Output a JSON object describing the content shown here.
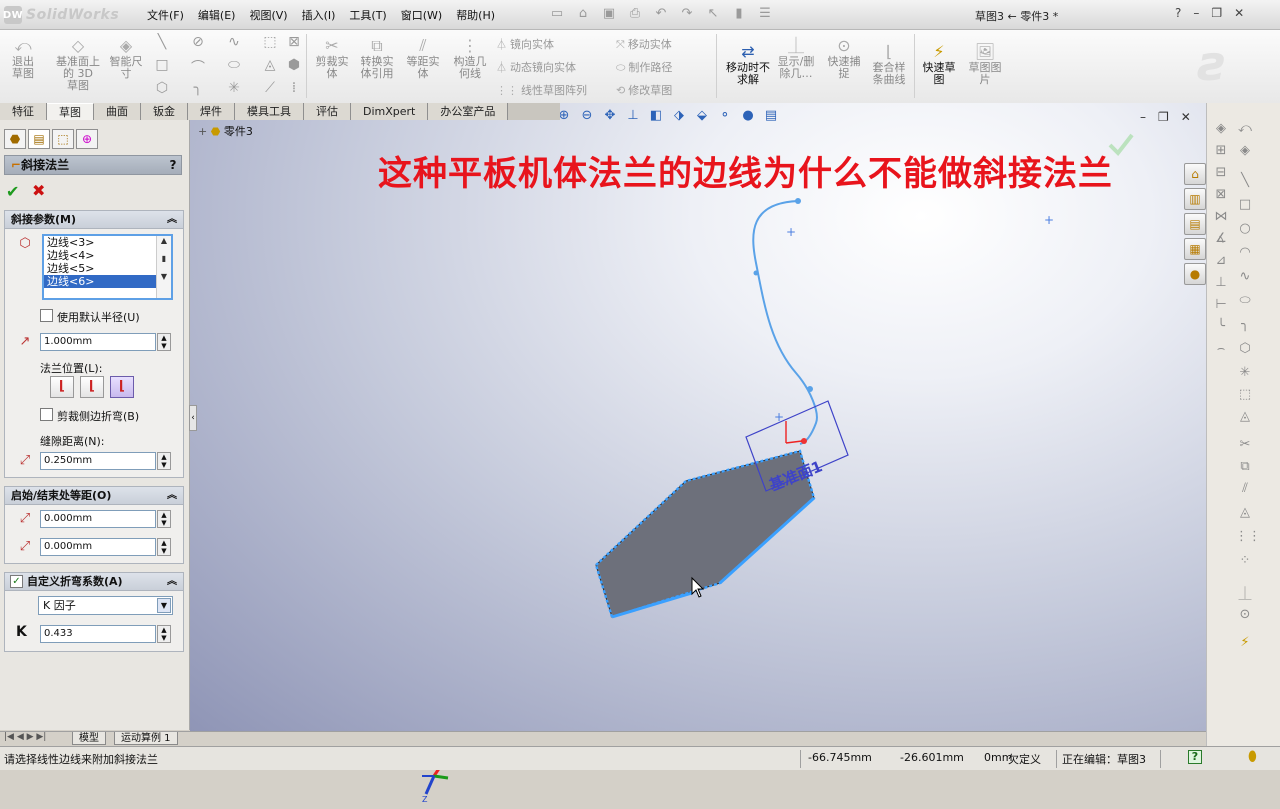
{
  "app": {
    "name": "SolidWorks",
    "document_title": "草图3 ← 零件3 *",
    "logo_mark": "DW"
  },
  "menu": [
    "文件(F)",
    "编辑(E)",
    "视图(V)",
    "插入(I)",
    "工具(T)",
    "窗口(W)",
    "帮助(H)"
  ],
  "window_controls": [
    "?",
    "–",
    "❐",
    "✕"
  ],
  "ribbon": {
    "exit_sketch": "退出草图",
    "plane_3d_sketch": "基准面上的 3D 草图",
    "smart_dim": "智能尺寸",
    "trim": "剪裁实体",
    "convert": "转换实体引用",
    "offset": "等距实体",
    "construct": "构造几何线",
    "mirror": "镜向实体",
    "dyn_mirror": "动态镜向实体",
    "linear_pattern": "线性草图阵列",
    "move": "移动实体",
    "make_path": "制作路径",
    "modify": "修改草图",
    "move_no_solve": "移动时不求解",
    "show_delete": "显示/删除几…",
    "quick_snap": "快速捕捉",
    "fit_spline": "套合样条曲线",
    "rapid_sketch": "快速草图",
    "sketch_picture": "草图图片"
  },
  "tabs": [
    "特征",
    "草图",
    "曲面",
    "钣金",
    "焊件",
    "模具工具",
    "评估",
    "DimXpert",
    "办公室产品"
  ],
  "active_tab": "草图",
  "tree": {
    "part": "零件3"
  },
  "annotation": "这种平板机体法兰的边线为什么不能做斜接法兰",
  "viewport": {
    "plane_label": "基准面1",
    "minimize": "–",
    "restore": "❐",
    "close": "✕"
  },
  "panel": {
    "title": "斜接法兰",
    "help": "?",
    "miter_params": "斜接参数(M)",
    "edges": [
      "边线<3>",
      "边线<4>",
      "边线<5>",
      "边线<6>"
    ],
    "selected_edge": "边线<6>",
    "use_default_radius": "使用默认半径(U)",
    "radius": "1.000mm",
    "flange_position": "法兰位置(L):",
    "trim_side_bends": "剪裁侧边折弯(B)",
    "gap_distance": "缝隙距离(N):",
    "gap": "0.250mm",
    "start_end_offset": "启始/结束处等距(O)",
    "d1": "0.000mm",
    "d2": "0.000mm",
    "custom_bend": "自定义折弯系数(A)",
    "bend_type": "K 因子",
    "k_label": "K",
    "k_value": "0.433"
  },
  "bottom_tabs": [
    "模型",
    "运动算例 1"
  ],
  "status": {
    "message": "请选择线性边线来附加斜接法兰",
    "x": "-66.745mm",
    "y": "-26.601mm",
    "z": "0mm",
    "defined": "欠定义",
    "editing": "正在编辑：草图3"
  },
  "colors": {
    "annotation": "#e8141c",
    "edge_highlight": "#3aa0ff",
    "face": "#6c6f7a",
    "selection": "#316ac5"
  }
}
